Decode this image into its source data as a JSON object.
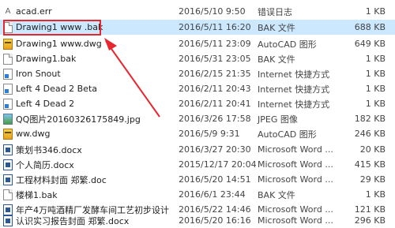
{
  "files": [
    {
      "name": "acad.err",
      "date": "2016/5/10 9:50",
      "type": "错误日志",
      "size": "1 KB",
      "icon": "text-icon"
    },
    {
      "name": "Drawing1  www .bak",
      "date": "2016/5/11 16:20",
      "type": "BAK 文件",
      "size": "688 KB",
      "icon": "doc-icon",
      "selected": true
    },
    {
      "name": "Drawing1  www.dwg",
      "date": "2016/5/11 23:09",
      "type": "AutoCAD 图形",
      "size": "649 KB",
      "icon": "dwg-icon"
    },
    {
      "name": "Drawing1.bak",
      "date": "2016/5/31 23:05",
      "type": "BAK 文件",
      "size": "1 KB",
      "icon": "doc-icon"
    },
    {
      "name": "Iron Snout",
      "date": "2016/2/15 21:35",
      "type": "Internet 快捷方式",
      "size": "1 KB",
      "icon": "link-icon"
    },
    {
      "name": "Left 4 Dead 2 Beta",
      "date": "2016/2/11 20:43",
      "type": "Internet 快捷方式",
      "size": "1 KB",
      "icon": "link-icon"
    },
    {
      "name": "Left 4 Dead 2",
      "date": "2016/2/11 20:41",
      "type": "Internet 快捷方式",
      "size": "1 KB",
      "icon": "link-icon"
    },
    {
      "name": "QQ图片20160326175849.jpg",
      "date": "2016/3/26 17:58",
      "type": "JPEG 图像",
      "size": "182 KB",
      "icon": "jpg-icon"
    },
    {
      "name": "ww.dwg",
      "date": "2016/5/9 9:31",
      "type": "AutoCAD 图形",
      "size": "246 KB",
      "icon": "dwg-icon"
    },
    {
      "name": "策划书346.docx",
      "date": "2016/3/27 20:30",
      "type": "Microsoft Word ...",
      "size": "20 KB",
      "icon": "word-icon"
    },
    {
      "name": "个人简历.docx",
      "date": "2015/12/17 20:04",
      "type": "Microsoft Word ...",
      "size": "415 KB",
      "icon": "word-icon"
    },
    {
      "name": "工程材料封面 郑繁.doc",
      "date": "2016/5/20 14:51",
      "type": "Microsoft Word ...",
      "size": "29 KB",
      "icon": "word-icon"
    },
    {
      "name": "楼梯1.bak",
      "date": "2016/6/1 23:44",
      "type": "BAK 文件",
      "size": "1 KB",
      "icon": "doc-icon"
    },
    {
      "name": "年产4万吨酒精厂发酵车间工艺初步设计 ...",
      "date": "2016/5/22 14:46",
      "type": "Microsoft Word ...",
      "size": "121 KB",
      "icon": "word-icon"
    },
    {
      "name": "认识实习报告封面 郑繁.docx",
      "date": "2016/5/20 16:16",
      "type": "Microsoft Word ...",
      "size": "296 KB",
      "icon": "word-icon"
    }
  ],
  "colors": {
    "selected_bg": "#cce8ff",
    "highlight": "#e8262f"
  }
}
